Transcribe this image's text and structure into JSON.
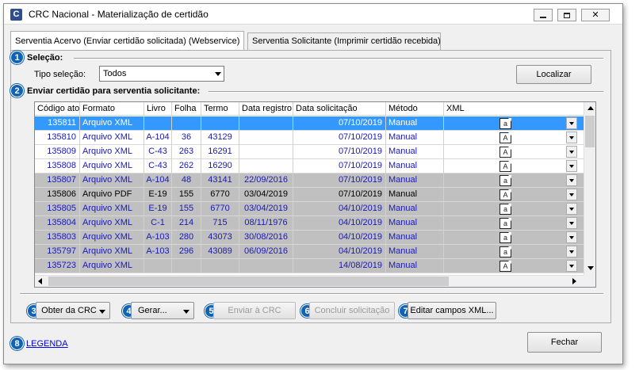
{
  "window": {
    "title": "CRC Nacional - Materialização de certidão",
    "icon_letter": "C"
  },
  "tabs": [
    {
      "label": "Serventia Acervo (Enviar certidão solicitada) (Webservice)",
      "active": true
    },
    {
      "label": "Serventia Solicitante (Imprimir certidão recebida)",
      "active": false
    }
  ],
  "badges": [
    "1",
    "2",
    "3",
    "4",
    "5",
    "6",
    "7",
    "8"
  ],
  "selecao": {
    "title": "Seleção:",
    "tipo_label": "Tipo seleção:",
    "tipo_value": "Todos",
    "localizar": "Localizar"
  },
  "enviar": {
    "title": "Enviar certidão para serventia solicitante:"
  },
  "grid": {
    "columns": [
      "Código ato",
      "Formato",
      "Livro",
      "Folha",
      "Termo",
      "Data registro",
      "Data solicitação",
      "Método",
      "XML"
    ],
    "rows": [
      {
        "codigo": "135811",
        "formato": "Arquivo XML",
        "livro": "",
        "folha": "",
        "termo": "",
        "data_registro": "",
        "data_solicitacao": "07/10/2019",
        "metodo": "Manual",
        "icon": "a",
        "style": "sel"
      },
      {
        "codigo": "135810",
        "formato": "Arquivo XML",
        "livro": "A-104",
        "folha": "36",
        "termo": "43129",
        "data_registro": "",
        "data_solicitacao": "07/10/2019",
        "metodo": "Manual",
        "icon": "A",
        "style": "white"
      },
      {
        "codigo": "135809",
        "formato": "Arquivo XML",
        "livro": "C-43",
        "folha": "263",
        "termo": "16291",
        "data_registro": "",
        "data_solicitacao": "07/10/2019",
        "metodo": "Manual",
        "icon": "A",
        "style": "white"
      },
      {
        "codigo": "135808",
        "formato": "Arquivo XML",
        "livro": "C-43",
        "folha": "262",
        "termo": "16290",
        "data_registro": "",
        "data_solicitacao": "07/10/2019",
        "metodo": "Manual",
        "icon": "A",
        "style": "white"
      },
      {
        "codigo": "135807",
        "formato": "Arquivo XML",
        "livro": "A-104",
        "folha": "48",
        "termo": "43141",
        "data_registro": "22/09/2016",
        "data_solicitacao": "07/10/2019",
        "metodo": "Manual",
        "icon": "a",
        "style": "gray"
      },
      {
        "codigo": "135806",
        "formato": "Arquivo PDF",
        "livro": "E-19",
        "folha": "155",
        "termo": "6770",
        "data_registro": "03/04/2019",
        "data_solicitacao": "07/10/2019",
        "metodo": "Manual",
        "icon": "A",
        "style": "grayblack"
      },
      {
        "codigo": "135805",
        "formato": "Arquivo XML",
        "livro": "E-19",
        "folha": "155",
        "termo": "6770",
        "data_registro": "03/04/2019",
        "data_solicitacao": "04/10/2019",
        "metodo": "Manual",
        "icon": "a",
        "style": "gray"
      },
      {
        "codigo": "135804",
        "formato": "Arquivo XML",
        "livro": "C-1",
        "folha": "214",
        "termo": "715",
        "data_registro": "08/11/1976",
        "data_solicitacao": "04/10/2019",
        "metodo": "Manual",
        "icon": "a",
        "style": "gray"
      },
      {
        "codigo": "135803",
        "formato": "Arquivo XML",
        "livro": "A-103",
        "folha": "280",
        "termo": "43073",
        "data_registro": "30/08/2016",
        "data_solicitacao": "04/10/2019",
        "metodo": "Manual",
        "icon": "a",
        "style": "gray"
      },
      {
        "codigo": "135797",
        "formato": "Arquivo XML",
        "livro": "A-103",
        "folha": "296",
        "termo": "43089",
        "data_registro": "06/09/2016",
        "data_solicitacao": "04/10/2019",
        "metodo": "Manual",
        "icon": "a",
        "style": "gray"
      },
      {
        "codigo": "135723",
        "formato": "Arquivo XML",
        "livro": "",
        "folha": "",
        "termo": "",
        "data_registro": "",
        "data_solicitacao": "14/08/2019",
        "metodo": "Manual",
        "icon": "A",
        "style": "gray"
      }
    ]
  },
  "actions": {
    "obter": "Obter da CRC",
    "gerar": "Gerar...",
    "enviar": "Enviar à CRC",
    "concluir": "Concluir solicitação",
    "editar": "Editar campos XML..."
  },
  "legenda": "LEGENDA",
  "fechar": "Fechar",
  "colors": {
    "accent": "#1262b3",
    "selected": "#3399ff",
    "gray_row": "#c0c0c0",
    "link_blue": "#1a1ab4"
  }
}
